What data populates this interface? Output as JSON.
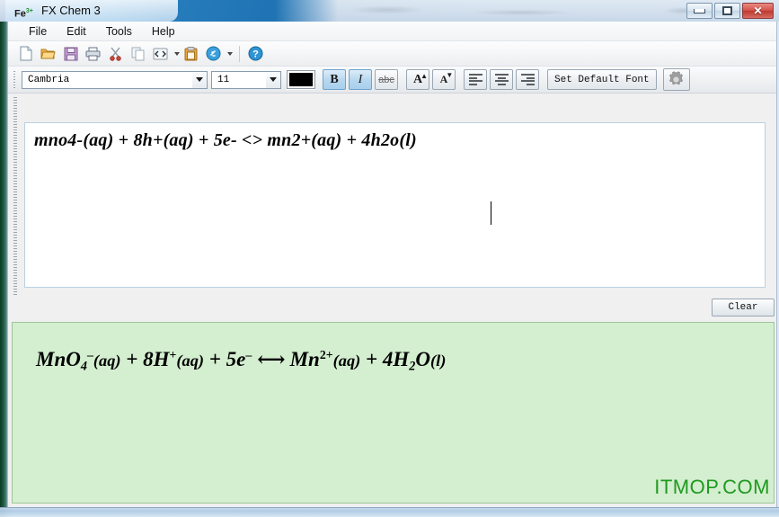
{
  "window": {
    "app_icon_text": "Fe",
    "app_icon_sup": "3+",
    "title": "FX Chem 3",
    "controls": {
      "minimize": "minimize-button",
      "maximize": "maximize-button",
      "close": "✕"
    }
  },
  "menubar": {
    "items": [
      {
        "label": "File",
        "name": "menu-file"
      },
      {
        "label": "Edit",
        "name": "menu-edit"
      },
      {
        "label": "Tools",
        "name": "menu-tools"
      },
      {
        "label": "Help",
        "name": "menu-help"
      }
    ]
  },
  "toolbar": {
    "icons": [
      "new-document-icon",
      "open-folder-icon",
      "save-floppy-icon",
      "print-icon",
      "cut-scissors-icon",
      "copy-icon",
      "code-brackets-icon",
      "paste-clipboard-icon",
      "link-icon",
      "help-question-icon"
    ]
  },
  "formatbar": {
    "font_family": "Cambria",
    "font_size": "11",
    "text_color": "#000000",
    "bold_label": "B",
    "bold_active": true,
    "italic_label": "I",
    "italic_active": true,
    "strikethrough_label": "abc",
    "superscript_label": "A",
    "superscript_marker": "▲",
    "subscript_label": "A",
    "subscript_marker": "▼",
    "align_left": "align-left",
    "align_center": "align-center",
    "align_right": "align-right",
    "set_default_font_label": "Set Default Font",
    "settings_icon": "gear-icon"
  },
  "editor": {
    "input_value": "mno4-(aq) + 8h+(aq) + 5e- <> mn2+(aq) + 4h2o(l)",
    "clear_label": "Clear"
  },
  "output": {
    "background_color": "#d4eed0",
    "equation_plain": "MnO4-(aq) + 8H+(aq) + 5e- <-> Mn2+(aq) + 4H2O(l)",
    "parts": {
      "mno4": "MnO",
      "mno4_sub": "4",
      "mno4_sup": "–",
      "aq1": "(aq)",
      "plus1": " + 8",
      "h": "H",
      "h_sup": "+",
      "aq2": "(aq)",
      "plus2": " + 5",
      "e": "e",
      "e_sup": "–",
      "arrow": "⟷",
      "mn": "Mn",
      "mn_sup": "2+",
      "aq3": "(aq)",
      "plus3": " + 4",
      "h2": "H",
      "h2_sub": "2",
      "o": "O",
      "state_l": "(l)"
    },
    "watermark": "ITMOP.COM"
  }
}
